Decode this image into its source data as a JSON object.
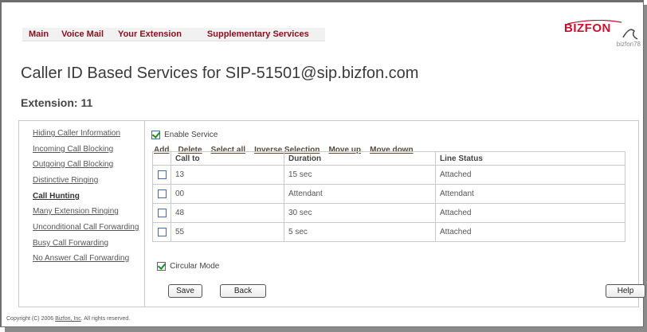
{
  "topnav": {
    "tabs": [
      "Main",
      "Voice Mail",
      "Your Extension",
      "Supplementary Services"
    ]
  },
  "logo": {
    "brand": "BIZFON",
    "sub": "bizfon78"
  },
  "title": "Caller ID Based Services for SIP-51501@sip.bizfon.com",
  "extension": "Extension: 11",
  "sidebar": {
    "items": [
      "Hiding Caller Information",
      "Incoming Call Blocking",
      "Outgoing Call Blocking",
      "Distinctive Ringing",
      "Call Hunting",
      "Many Extension Ringing",
      "Unconditional Call Forwarding",
      "Busy Call Forwarding",
      "No Answer Call Forwarding"
    ],
    "active_index": 4
  },
  "enable_service": {
    "label": "Enable Service",
    "checked": true
  },
  "actions": [
    "Add",
    "Delete",
    "Select all",
    "Inverse Selection",
    "Move up",
    "Move down"
  ],
  "table": {
    "headers": [
      "Call to",
      "Duration",
      "Line Status"
    ],
    "rows": [
      {
        "call_to": "13",
        "duration": "15 sec",
        "status": "Attached"
      },
      {
        "call_to": "00",
        "duration": "Attendant",
        "status": "Attendant"
      },
      {
        "call_to": "48",
        "duration": "30 sec",
        "status": "Attached"
      },
      {
        "call_to": "55",
        "duration": "5 sec",
        "status": "Attached"
      }
    ]
  },
  "circular_mode": {
    "label": "Circular Mode",
    "checked": true
  },
  "buttons": {
    "save": "Save",
    "back": "Back",
    "help": "Help"
  },
  "footer": {
    "prefix": "Copyright (C) 2006 ",
    "link": "Bizfon, Inc",
    "suffix": ". All rights reserved."
  },
  "colors": {
    "accent": "#8b1020",
    "logo": "#c8102e",
    "check": "#1f8b1f"
  }
}
